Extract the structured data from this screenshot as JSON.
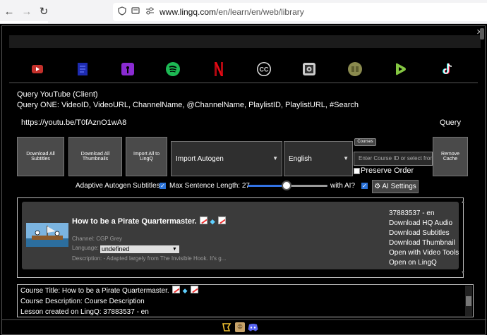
{
  "browser": {
    "url_host": "www.lingq.com",
    "url_path": "/en/learn/en/web/library",
    "icons": [
      "back-icon",
      "forward-icon",
      "reload-icon",
      "shield-icon",
      "page-info-icon",
      "permissions-icon"
    ]
  },
  "services": [
    {
      "name": "youtube-icon",
      "color": "#c4302b"
    },
    {
      "name": "document-icon",
      "color": "#1d2bb0"
    },
    {
      "name": "podcast-icon",
      "color": "#8a2bd2"
    },
    {
      "name": "spotify-icon",
      "color": "#1db954"
    },
    {
      "name": "netflix-icon",
      "color": "#e50914"
    },
    {
      "name": "closed-captions-icon",
      "color": "#dddddd"
    },
    {
      "name": "audio-file-icon",
      "color": "#cccccc"
    },
    {
      "name": "book-icon",
      "color": "#8a8a4e"
    },
    {
      "name": "rumble-icon",
      "color": "#85c742"
    },
    {
      "name": "tiktok-icon",
      "color": "#ffffff"
    }
  ],
  "query": {
    "title": "Query YouTube (Client)",
    "help": "Query ONE: VideoID, VideoURL, ChannelName, @ChannelName, PlaylistID, PlaylistURL, #Search",
    "input_value": "https://youtu.be/T0fAznO1wA8",
    "button_label": "Query"
  },
  "actions": {
    "download_subtitles": "Download All Subtitles",
    "download_thumbnails": "Download All Thumbnails",
    "import_all": "Import All to LingQ",
    "import_mode": "Import Autogen",
    "language": "English",
    "courses_tag": "Courses",
    "course_placeholder": "Enter Course ID or select from",
    "preserve_order": "Preserve Order",
    "remove_cache": "Remove Cache"
  },
  "options": {
    "adaptive_label": "Adaptive Autogen Subtitles",
    "max_sentence_label": "Max Sentence Length: 27",
    "max_sentence_value": 27,
    "slider_fraction": 0.53,
    "with_ai_label": "with AI?",
    "ai_settings_label": "⚙ AI Settings"
  },
  "lesson": {
    "title": "How to be a Pirate Quartermaster.",
    "channel_label": "Channel:",
    "channel": "CGP Grey",
    "language_label": "Language:",
    "language_value": "undefined",
    "description_label": "Description:",
    "description": "- Adapted largely from The Invisible Hook. It's g...",
    "id_line": "37883537 - en",
    "links": [
      "Download HQ Audio",
      "Download Subtitles",
      "Download Thumbnail",
      "Open with Video Tools",
      "Open on LingQ"
    ]
  },
  "log": [
    "Course Title: How to be a Pirate Quartermaster.",
    "Course Description: Course Description",
    "Lesson created on LingQ: 37883537 - en"
  ],
  "footer_icons": [
    "lingq-icon",
    "avatar-icon",
    "discord-icon"
  ]
}
